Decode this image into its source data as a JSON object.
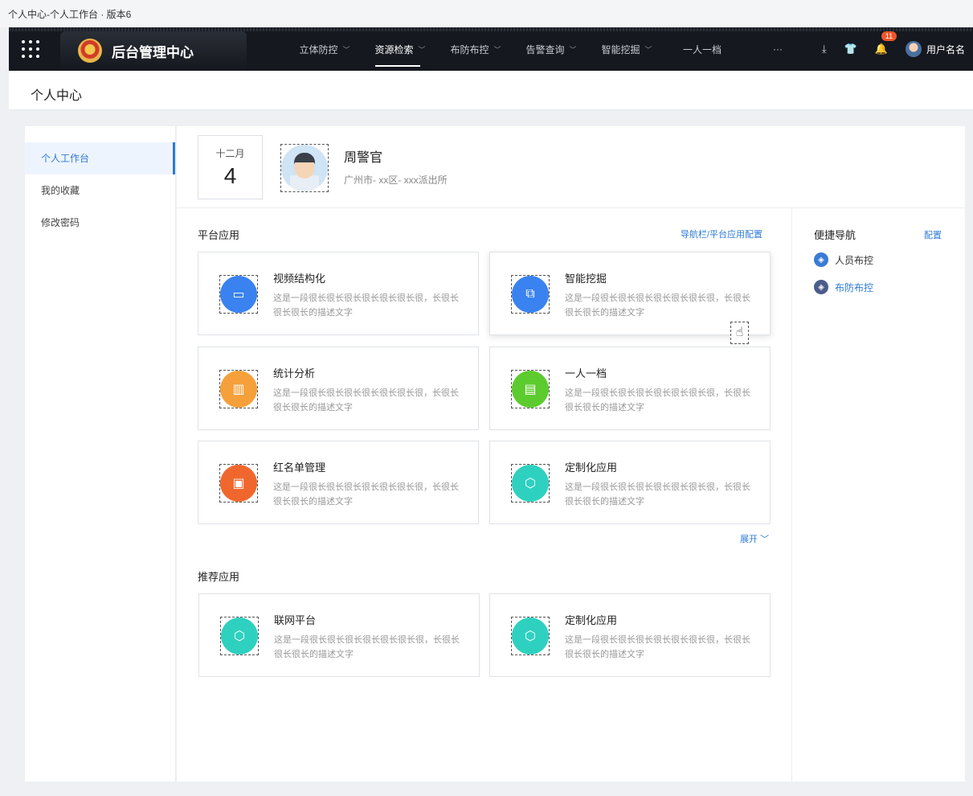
{
  "doc_title": "个人中心-个人工作台 · 版本6",
  "topbar": {
    "brand": "后台管理中心",
    "nav": [
      {
        "label": "立体防控",
        "has_arrow": true
      },
      {
        "label": "资源检索",
        "has_arrow": true,
        "active": true
      },
      {
        "label": "布防布控",
        "has_arrow": true
      },
      {
        "label": "告警查询",
        "has_arrow": true
      },
      {
        "label": "智能挖掘",
        "has_arrow": true
      },
      {
        "label": "一人一档",
        "has_arrow": false
      },
      {
        "label": "···",
        "has_arrow": false
      }
    ],
    "notification_count": "11",
    "username": "用户名名"
  },
  "page_title": "个人中心",
  "sidebar": {
    "items": [
      {
        "label": "个人工作台",
        "active": true
      },
      {
        "label": "我的收藏"
      },
      {
        "label": "修改密码"
      }
    ]
  },
  "profile": {
    "month": "十二月",
    "day": "4",
    "name": "周警官",
    "address": "广州市- xx区- xxx派出所"
  },
  "platform": {
    "title": "平台应用",
    "config_link": "导航栏/平台应用配置",
    "expand": "展开",
    "cards": [
      {
        "title": "视频结构化",
        "desc": "这是一段很长很长很长很长很长很长很，长很长很长很长的描述文字",
        "color": "#3a82ef",
        "icon": "video-icon",
        "glyph": "▭"
      },
      {
        "title": "智能挖掘",
        "desc": "这是一段很长很长很长很长很长很长很，长很长很长很长的描述文字",
        "color": "#3a82ef",
        "icon": "data-search-icon",
        "glyph": "⧉"
      },
      {
        "title": "统计分析",
        "desc": "这是一段很长很长很长很长很长很长很，长很长很长很长的描述文字",
        "color": "#f5a03a",
        "icon": "bar-chart-icon",
        "glyph": "▥"
      },
      {
        "title": "一人一档",
        "desc": "这是一段很长很长很长很长很长很长很，长很长很长很长的描述文字",
        "color": "#5ccb2e",
        "icon": "profile-doc-icon",
        "glyph": "▤"
      },
      {
        "title": "红名单管理",
        "desc": "这是一段很长很长很长很长很长很长很，长很长很长很长的描述文字",
        "color": "#f0672e",
        "icon": "contact-book-icon",
        "glyph": "▣"
      },
      {
        "title": "定制化应用",
        "desc": "这是一段很长很长很长很长很长很长很，长很长很长很长的描述文字",
        "color": "#2ed1bf",
        "icon": "cube-icon",
        "glyph": "⬡"
      }
    ]
  },
  "recommended": {
    "title": "推荐应用",
    "cards": [
      {
        "title": "联网平台",
        "desc": "这是一段很长很长很长很长很长很长很，长很长很长很长的描述文字",
        "color": "#2ed1bf",
        "icon": "cube-icon",
        "glyph": "⬡"
      },
      {
        "title": "定制化应用",
        "desc": "这是一段很长很长很长很长很长很长很，长很长很长很长的描述文字",
        "color": "#2ed1bf",
        "icon": "cube-icon",
        "glyph": "⬡"
      }
    ]
  },
  "quick_nav": {
    "title": "便捷导航",
    "config": "配置",
    "items": [
      {
        "label": "人员布控"
      },
      {
        "label": "布防布控",
        "active": true
      }
    ]
  }
}
